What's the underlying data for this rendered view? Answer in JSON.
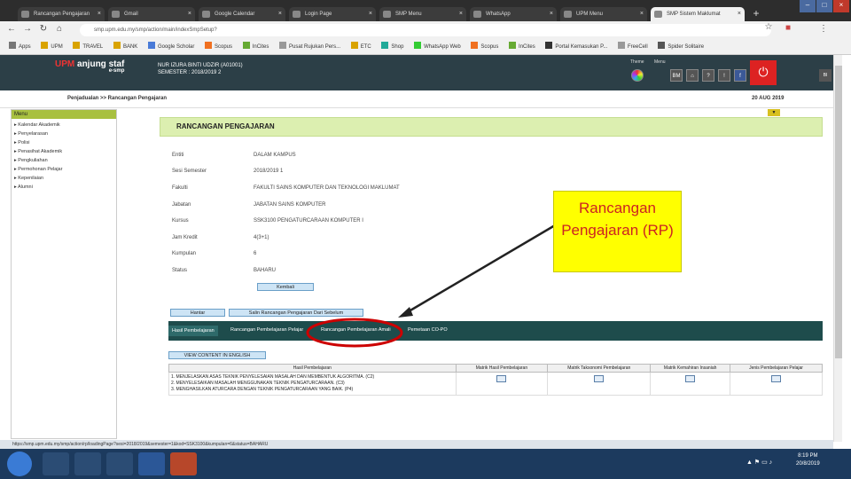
{
  "browser": {
    "tabs": [
      {
        "label": "Rancangan Pengajaran",
        "active": false
      },
      {
        "label": "Gmail",
        "active": false
      },
      {
        "label": "Google Calendar",
        "active": false
      },
      {
        "label": "Login Page",
        "active": false
      },
      {
        "label": "SMP Menu",
        "active": false
      },
      {
        "label": "WhatsApp",
        "active": false
      },
      {
        "label": "UPM Menu",
        "active": false
      },
      {
        "label": "SMP Sistem Maklumat",
        "active": true
      }
    ],
    "url": "smp.upm.edu.my/smp/action/main/indexSmpSetup?",
    "bookmarks": [
      "Apps",
      "UPM",
      "TRAVEL",
      "BANK",
      "Google Scholar",
      "Scopus",
      "InCites",
      "Pusat Rujukan Pers...",
      "ETC",
      "Shop",
      "WhatsApp Web",
      "Scopus",
      "InCites",
      "Portal Kemasukan P...",
      "FreeCell",
      "Spider Solitaire"
    ]
  },
  "header": {
    "brand_upm": "UPM",
    "brand_name": "anjung staf",
    "brand_sub": "e-smp",
    "user_line1": "NUR IZURA BINTI UDZIR (A01001)",
    "user_line2": "SEMESTER : 2018/2019 2",
    "theme_label": "Theme",
    "menu_label": "Menu",
    "buttons": [
      "BM",
      "⌂",
      "?",
      "!",
      "f"
    ],
    "collapse": "BI"
  },
  "breadcrumb": "Penjadualan >> Rancangan Pengajaran",
  "date": "20 AUG 2019",
  "sidebar": {
    "title": "Menu",
    "items": [
      "Kalendar Akademik",
      "Penyelarasan",
      "Polisi",
      "Penasihat Akademik",
      "Pengkuliahan",
      "Permohonan Pelajar",
      "Kepenilaian",
      "Alumni"
    ]
  },
  "main": {
    "toggle": "▼",
    "title": "RANCANGAN PENGAJARAN",
    "fields": [
      {
        "label": "Entiti",
        "value": "DALAM KAMPUS"
      },
      {
        "label": "Sesi Semester",
        "value": "2018/2019 1"
      },
      {
        "label": "Fakulti",
        "value": "FAKULTI SAINS KOMPUTER DAN TEKNOLOGI MAKLUMAT"
      },
      {
        "label": "Jabatan",
        "value": "JABATAN SAINS KOMPUTER"
      },
      {
        "label": "Kursus",
        "value": "SSK3100 PENGATURCARAAN KOMPUTER I"
      },
      {
        "label": "Jam Kredit",
        "value": "4(3+1)"
      },
      {
        "label": "Kumpulan",
        "value": "6"
      },
      {
        "label": "Status",
        "value": "BAHARU"
      }
    ],
    "back_button": "Kembali",
    "action_buttons": [
      "Hantar",
      "Salin Rancangan Pengajaran Dari Sebelum"
    ],
    "tabs": [
      "Hasil Pembelajaran",
      "Rancangan Pembelajaran Pelajar",
      "Rancangan Pembelajaran Amali",
      "Pemetaan CO-PO"
    ],
    "english_button": "VIEW CONTENT IN ENGLISH",
    "table": {
      "headers": [
        "Hasil Pembelajaran",
        "Matrik Hasil Pembelajaran",
        "Matrik Taksonomi Pembelajaran",
        "Matrik Kemahiran Insaniah",
        "Jenis Pembelajaran Pelajar"
      ],
      "rows": [
        "1. MENJELASKAN ASAS TEKNIK PENYELESAIAN MASALAH DAN MEMBENTUK ALGORITMA. (C2)",
        "2. MENYELESAIKAN MASALAH MENGGUNAKAN TEKNIK PENGATURCARAAN. (C3)",
        "3. MENGHASILKAN ATURCARA DENGAN TEKNIK PENGATURCARAAN YANG BAIK. (P4)"
      ]
    }
  },
  "callout": {
    "line1": "Rancangan",
    "line2": "Pengajaran (RP)",
    "color": "#ffff00",
    "text_color": "#cc2222"
  },
  "annotation_ellipse_color": "#cc0000",
  "status_url": "https://smp.upm.edu.my/smp/action/rp/loadingPage?sesi=2018/2019&semester=1&kod=SSK3100&kumpulan=6&status=BAHARU",
  "taskbar": {
    "time": "8:19 PM",
    "date": "20/8/2019"
  }
}
